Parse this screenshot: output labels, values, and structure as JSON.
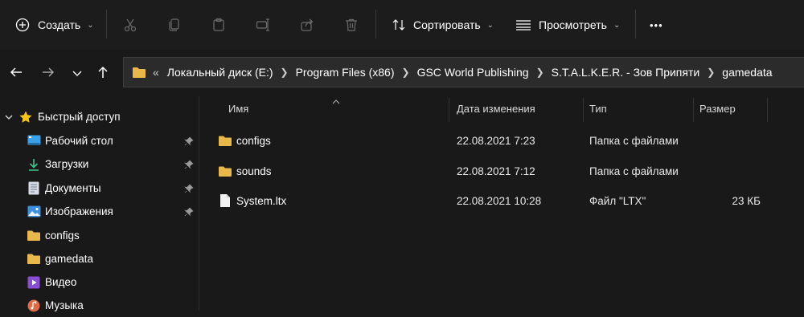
{
  "toolbar": {
    "create_label": "Создать",
    "sort_label": "Сортировать",
    "view_label": "Просмотреть",
    "more_label": "•••"
  },
  "address": {
    "overflow": "«",
    "crumbs": [
      "Локальный диск (E:)",
      "Program Files (x86)",
      "GSC World Publishing",
      "S.T.A.L.K.E.R. - Зов Припяти",
      "gamedata"
    ]
  },
  "sidebar": {
    "quick_access": "Быстрый доступ",
    "items": [
      {
        "label": "Рабочий стол",
        "icon": "desktop-icon",
        "pinned": true
      },
      {
        "label": "Загрузки",
        "icon": "downloads-icon",
        "pinned": true
      },
      {
        "label": "Документы",
        "icon": "documents-icon",
        "pinned": true
      },
      {
        "label": "Изображения",
        "icon": "pictures-icon",
        "pinned": true
      },
      {
        "label": "configs",
        "icon": "folder-icon",
        "pinned": false
      },
      {
        "label": "gamedata",
        "icon": "folder-icon",
        "pinned": false
      },
      {
        "label": "Видео",
        "icon": "video-icon",
        "pinned": false
      },
      {
        "label": "Музыка",
        "icon": "music-icon",
        "pinned": false
      }
    ]
  },
  "columns": {
    "name": "Имя",
    "date": "Дата изменения",
    "type": "Тип",
    "size": "Размер"
  },
  "files": [
    {
      "name": "configs",
      "date": "22.08.2021 7:23",
      "type": "Папка с файлами",
      "size": "",
      "icon": "folder-icon"
    },
    {
      "name": "sounds",
      "date": "22.08.2021 7:12",
      "type": "Папка с файлами",
      "size": "",
      "icon": "folder-icon"
    },
    {
      "name": "System.ltx",
      "date": "22.08.2021 10:28",
      "type": "Файл \"LTX\"",
      "size": "23 КБ",
      "icon": "file-icon"
    }
  ],
  "colors": {
    "folder": "#e8b84a",
    "accent": "#4cc2ff",
    "background": "#191919"
  }
}
